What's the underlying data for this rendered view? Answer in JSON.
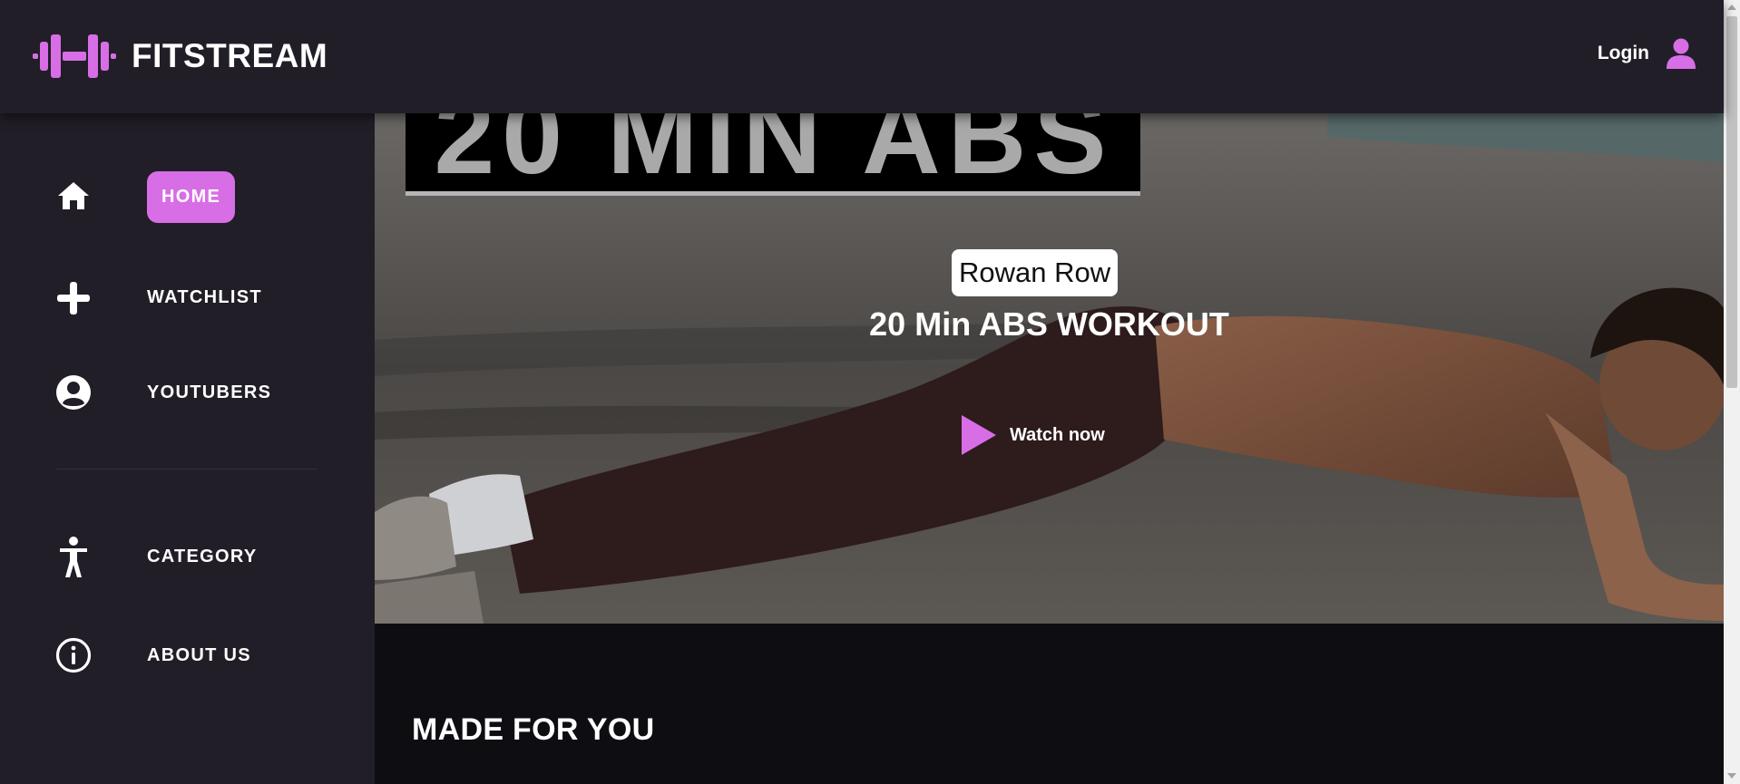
{
  "header": {
    "brand": "FITSTREAM",
    "login_label": "Login",
    "accent_color": "#d76ee6",
    "logo_icon": "dumbbell-icon",
    "user_icon": "user-icon"
  },
  "sidebar": {
    "items": [
      {
        "label": "HOME",
        "icon": "home-icon",
        "active": true
      },
      {
        "label": "WATCHLIST",
        "icon": "plus-icon"
      },
      {
        "label": "YOUTUBERS",
        "icon": "user-circle-icon"
      },
      {
        "label": "CATEGORY",
        "icon": "accessibility-icon"
      },
      {
        "label": "ABOUT US",
        "icon": "info-icon"
      }
    ]
  },
  "hero": {
    "banner_text": "20 MIN ABS",
    "author": "Rowan Row",
    "title": "20 Min ABS WORKOUT",
    "watch_label": "Watch now",
    "play_icon": "play-icon"
  },
  "sections": {
    "made_for_you": "MADE FOR YOU"
  }
}
